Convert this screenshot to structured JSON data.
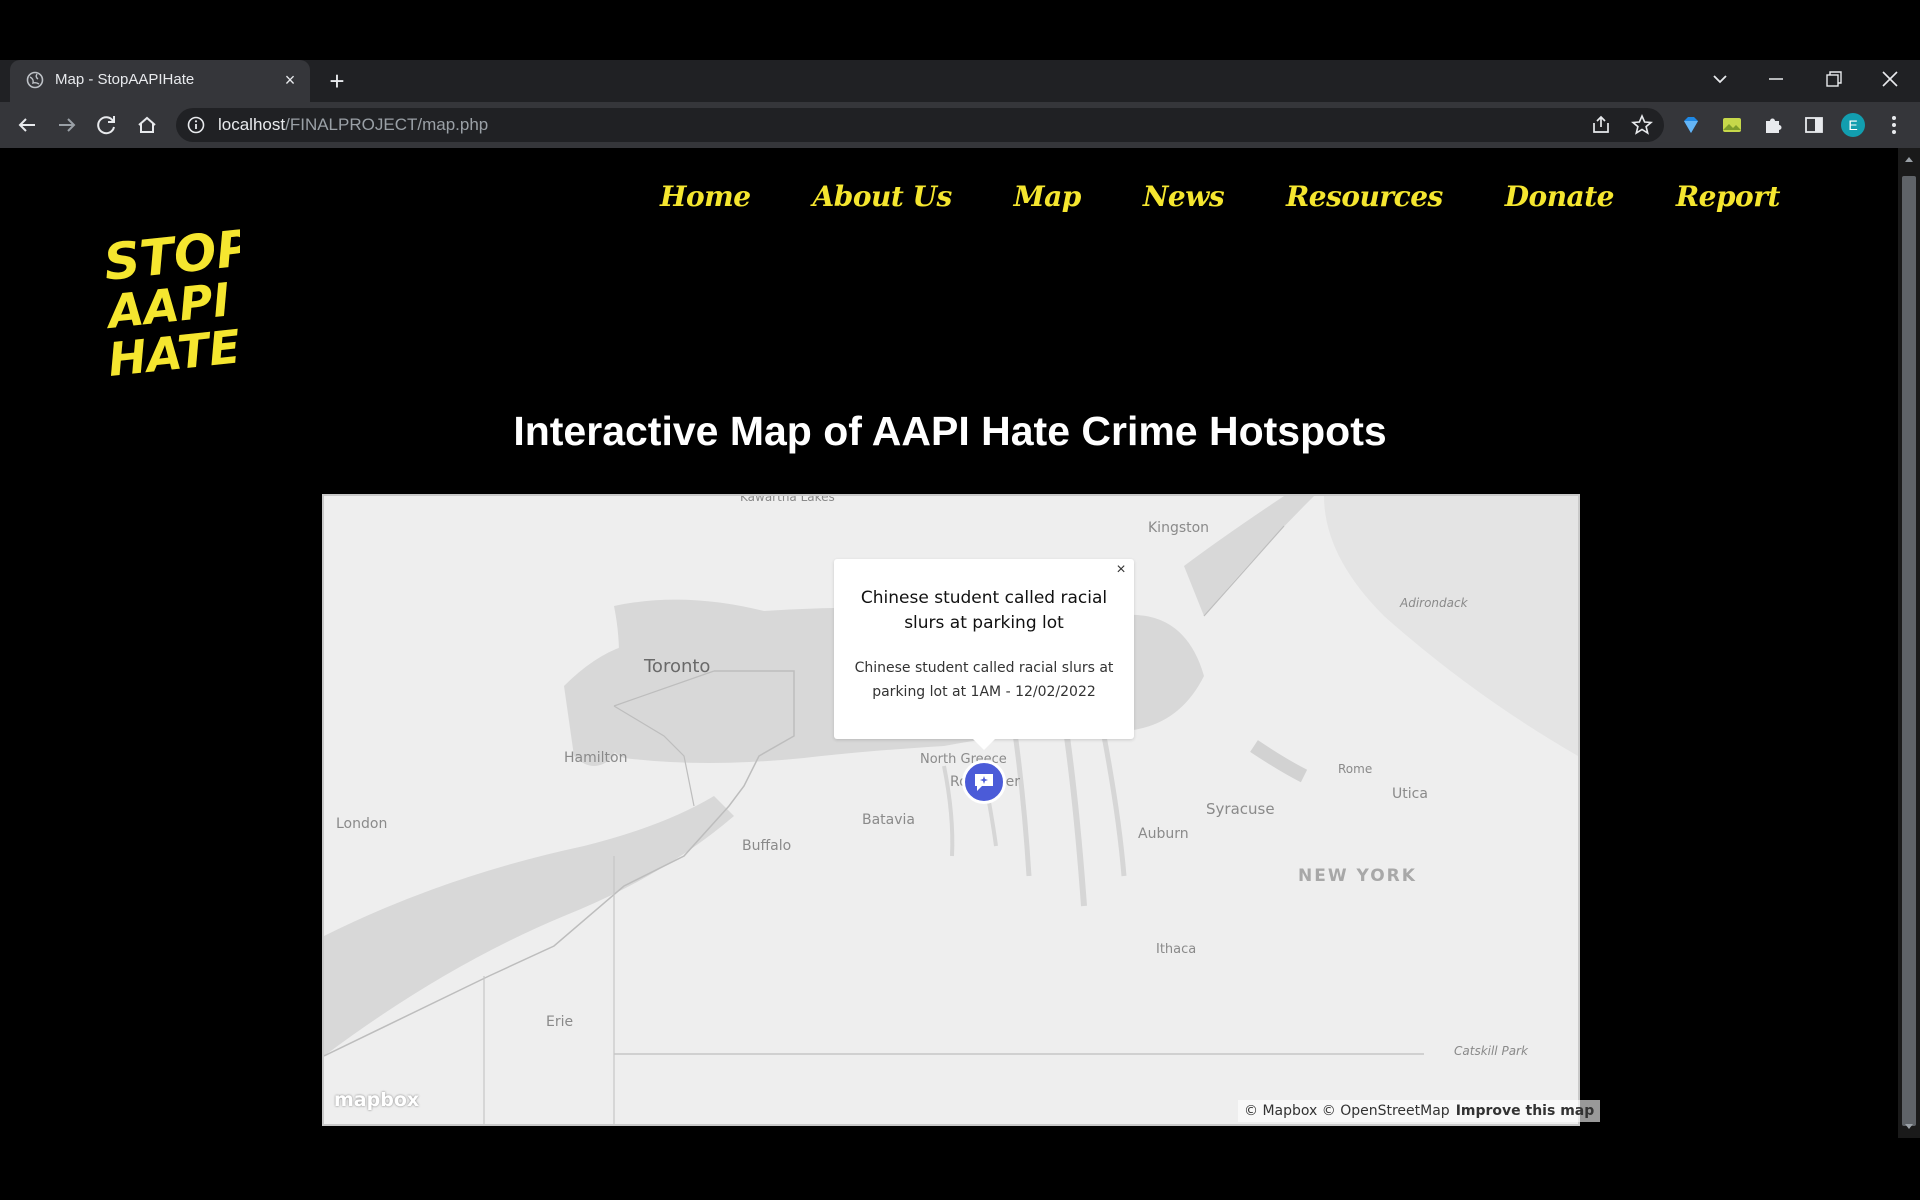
{
  "browser": {
    "tab_title": "Map - StopAAPIHate",
    "url_host": "localhost",
    "url_path": "/FINALPROJECT/map.php",
    "profile_initial": "E",
    "tab_close_glyph": "×",
    "new_tab_glyph": "+"
  },
  "nav": {
    "items": [
      "Home",
      "About Us",
      "Map",
      "News",
      "Resources",
      "Donate",
      "Report"
    ],
    "color": "#f5e62f"
  },
  "logo": {
    "lines": [
      "STOP",
      "AAPI",
      "HATE"
    ]
  },
  "page": {
    "title": "Interactive Map of AAPI Hate Crime Hotspots"
  },
  "map": {
    "labels": {
      "kawartha": "Kawartha Lakes",
      "kingston": "Kingston",
      "adirondack": "Adirondack",
      "toronto": "Toronto",
      "hamilton": "Hamilton",
      "london": "London",
      "north_greece": "North Greece",
      "rochester": "Rochester",
      "rome": "Rome",
      "utica": "Utica",
      "syracuse": "Syracuse",
      "batavia": "Batavia",
      "auburn": "Auburn",
      "buffalo": "Buffalo",
      "new_york": "NEW YORK",
      "ithaca": "Ithaca",
      "erie": "Erie",
      "catskill": "Catskill Park"
    },
    "popup": {
      "title": "Chinese student called racial slurs at parking lot",
      "description": "Chinese student called racial slurs at parking lot at 1AM - 12/02/2022",
      "close_glyph": "×"
    },
    "marker_color": "#4b5bd8",
    "mapbox_logo": "mapbox",
    "attribution": "© Mapbox © OpenStreetMap",
    "improve_link": "Improve this map"
  }
}
